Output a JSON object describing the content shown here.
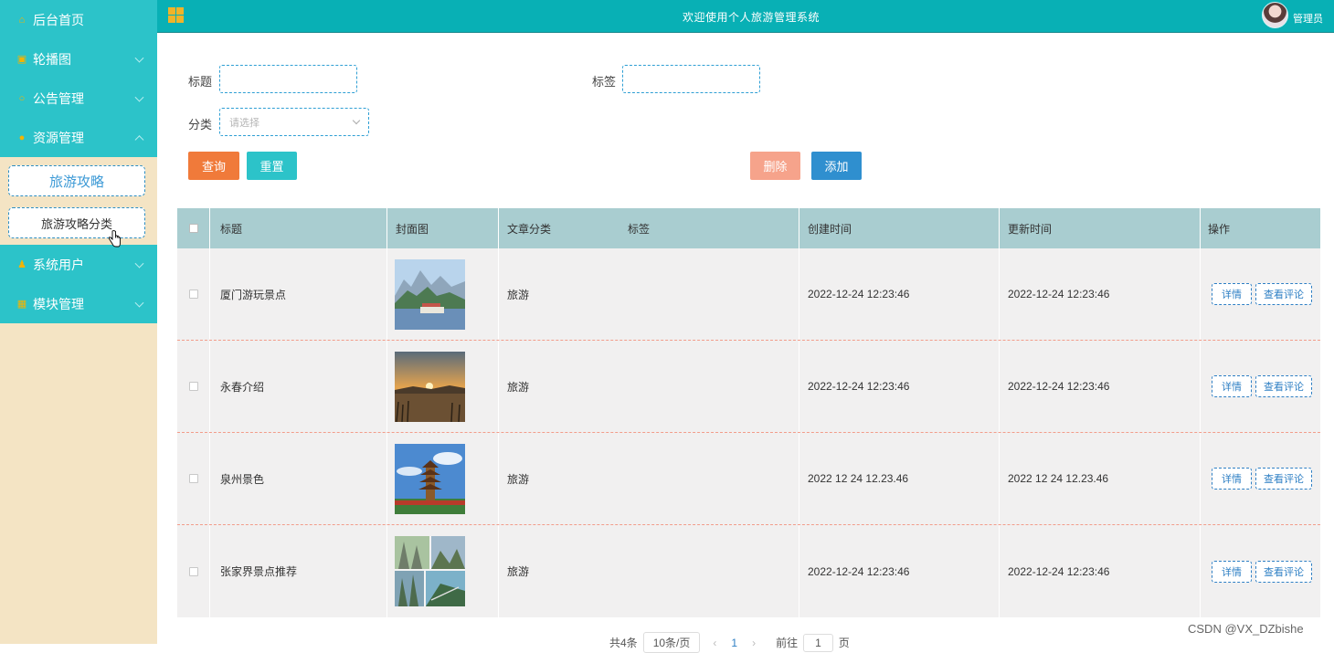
{
  "sidebar": {
    "items": [
      {
        "label": "后台首页",
        "icon": "home-icon",
        "glyph": "⌂"
      },
      {
        "label": "轮播图",
        "icon": "image-icon",
        "glyph": "▣"
      },
      {
        "label": "公告管理",
        "icon": "circle-icon",
        "glyph": "○"
      },
      {
        "label": "资源管理",
        "icon": "shield-icon",
        "glyph": "●"
      }
    ],
    "submenu": [
      "旅游攻略",
      "旅游攻略分类"
    ],
    "items_after": [
      {
        "label": "系统用户",
        "icon": "user-icon",
        "glyph": "♟"
      },
      {
        "label": "模块管理",
        "icon": "grid-icon",
        "glyph": "▦"
      }
    ]
  },
  "header": {
    "title": "欢迎使用个人旅游管理系统",
    "user": "管理员"
  },
  "search": {
    "title_label": "标题",
    "tag_label": "标签",
    "category_label": "分类",
    "category_placeholder": "请选择"
  },
  "buttons": {
    "query": "查询",
    "reset": "重置",
    "delete": "删除",
    "add": "添加"
  },
  "colors": {
    "sidebar_bg": "#f4e4c4",
    "menu_bg": "#2cc3c9",
    "header_bg": "#08b0b5",
    "query_btn": "#f07a3a",
    "reset_btn": "#2cc3c9",
    "delete_btn": "#f6a38b",
    "add_btn": "#2f8fcf",
    "table_header": "#a9cdd0"
  },
  "table": {
    "headers": [
      "标题",
      "封面图",
      "文章分类",
      "标签",
      "创建时间",
      "更新时间",
      "操作"
    ],
    "rows": [
      {
        "title": "厦门游玩景点",
        "category": "旅游",
        "created": "2022-12-24 12:23:46",
        "updated": "2022-12-24 12:23:46",
        "image": "lake-island-icon"
      },
      {
        "title": "永春介绍",
        "category": "旅游",
        "created": "2022-12-24 12:23:46",
        "updated": "2022-12-24 12:23:46",
        "image": "sunset-lake-icon"
      },
      {
        "title": "泉州景色",
        "category": "旅游",
        "created": "2022 12 24 12.23.46",
        "updated": "2022 12 24 12.23.46",
        "image": "pagoda-icon"
      },
      {
        "title": "张家界景点推荐",
        "category": "旅游",
        "created": "2022-12-24 12:23:46",
        "updated": "2022-12-24 12:23:46",
        "image": "mountain-collage-icon"
      }
    ],
    "detail_label": "详情",
    "comment_label": "查看评论"
  },
  "pager": {
    "total": "共4条",
    "page_size": "10条/页",
    "prev": "‹",
    "page": "1",
    "next": "›",
    "goto_label": "前往",
    "goto_value": "1",
    "page_unit": "页"
  },
  "watermark": "CSDN @VX_DZbishe"
}
